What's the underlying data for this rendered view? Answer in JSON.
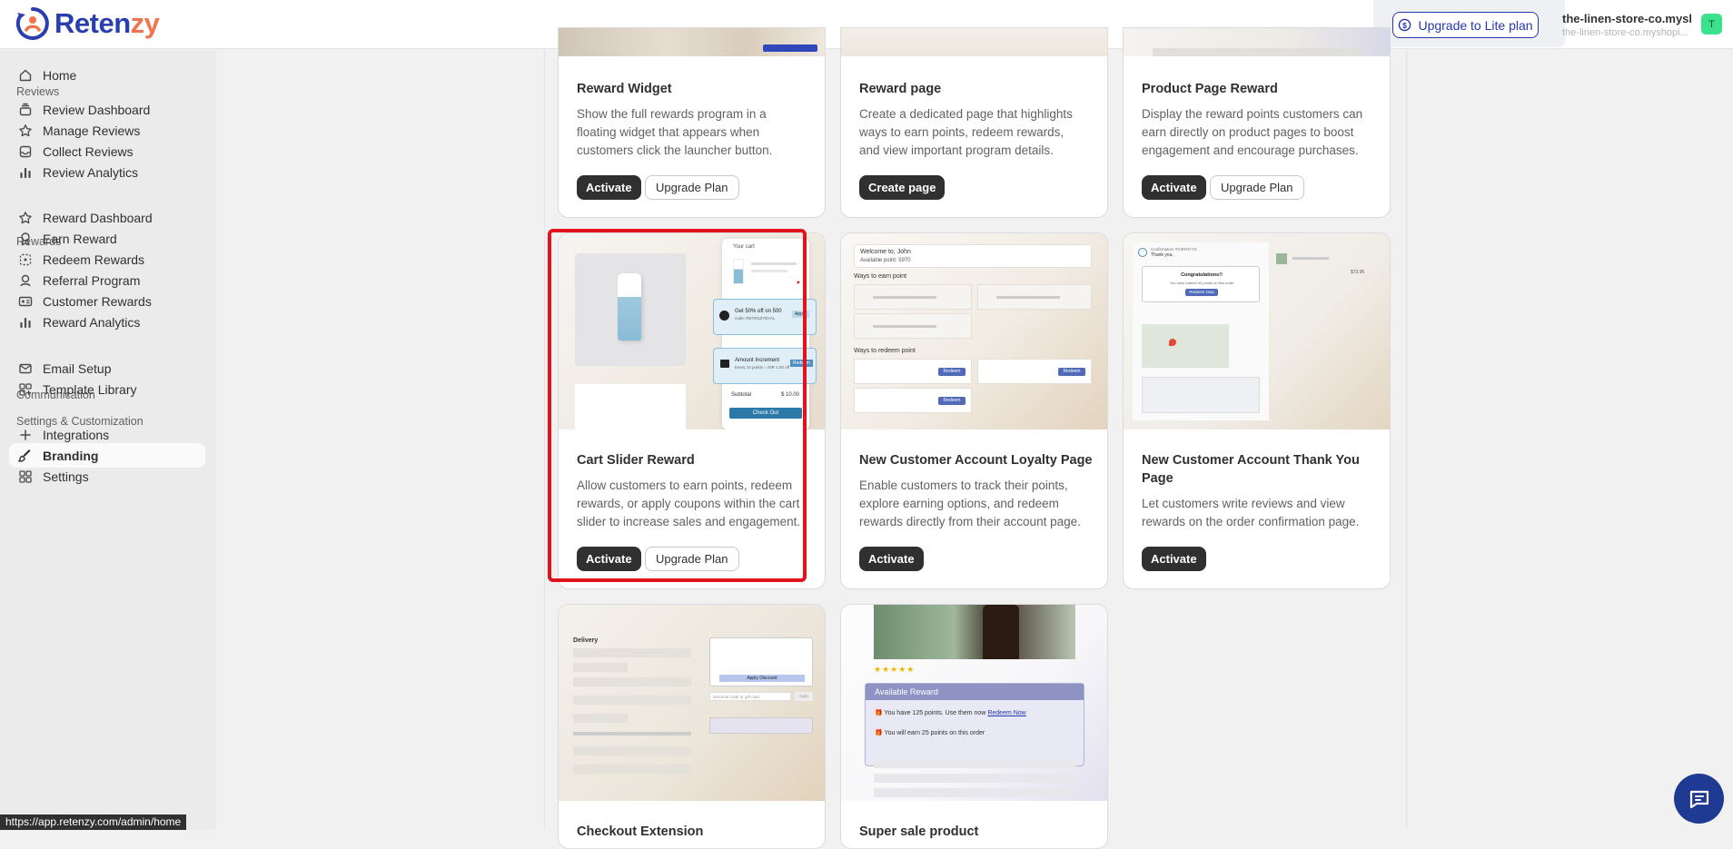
{
  "app": {
    "logo_a": "Reten",
    "logo_b": "zy"
  },
  "topbar": {
    "upgrade_label": "Upgrade to Lite plan",
    "store_name": "the-linen-store-co.mysh...",
    "store_domain": "the-linen-store-co.myshopi...",
    "avatar_letter": "T"
  },
  "sidebar": {
    "home": "Home",
    "reviews_heading": "Reviews",
    "reviews": [
      "Review Dashboard",
      "Manage Reviews",
      "Collect Reviews",
      "Review Analytics"
    ],
    "rewards_heading": "Rewards",
    "rewards": [
      "Reward Dashboard",
      "Earn Reward",
      "Redeem Rewards",
      "Referral Program",
      "Customer Rewards",
      "Reward Analytics"
    ],
    "communication_heading": "Communication",
    "communication": [
      "Email Setup",
      "Template Library"
    ],
    "settings_heading": "Settings & Customization",
    "settings": [
      "Integrations",
      "Branding",
      "Settings"
    ]
  },
  "cards": [
    {
      "title": "Reward Widget",
      "desc": "Show the full rewards program in a floating widget that appears when customers click the launcher button.",
      "primary": "Activate",
      "secondary": "Upgrade Plan"
    },
    {
      "title": "Reward page",
      "desc": "Create a dedicated page that highlights ways to earn points, redeem rewards, and view important program details.",
      "primary": "Create page"
    },
    {
      "title": "Product Page Reward",
      "desc": "Display the reward points customers can earn directly on product pages to boost engagement and encourage purchases.",
      "primary": "Activate",
      "secondary": "Upgrade Plan"
    },
    {
      "title": "Cart Slider Reward",
      "desc": "Allow customers to earn points, redeem rewards, or apply coupons within the cart slider to increase sales and engagement.",
      "primary": "Activate",
      "secondary": "Upgrade Plan"
    },
    {
      "title": "New Customer Account Loyalty Page",
      "desc": "Enable customers to track their points, explore earning options, and redeem rewards directly from their account page.",
      "primary": "Activate"
    },
    {
      "title": "New Customer Account Thank You Page",
      "desc": "Let customers write reviews and view rewards on the order confirmation page.",
      "primary": "Activate"
    },
    {
      "title": "Checkout Extension"
    },
    {
      "title": "Super sale product"
    }
  ],
  "previews": {
    "cart": {
      "heading": "Your cart",
      "coupon": "Get 50% off on 500",
      "coupon_code": "code: RETENZYBYAL",
      "coupon_action": "Apply",
      "points": "Amount Increment",
      "points_sub": "Every 10 points = INR 1.00 off",
      "points_action": "Redeem",
      "subtotal_label": "Subtotal",
      "subtotal_value": "$ 10.00",
      "checkout": "Check Out"
    },
    "loyalty": {
      "welcome": "Welcome to, John",
      "available": "Available point: 5970",
      "earn": "Ways to earn point",
      "redeem": "Ways to redeem point",
      "redeem_btn": "Redeem"
    },
    "thankyou": {
      "order": "Confirmation #G3RNYYS",
      "thanks": "Thank you,",
      "congrats": "Congratulations!!",
      "sub": "You have earned 40 points on this order",
      "btn": "Redeem Now",
      "price": "$73.95"
    },
    "checkout": {
      "heading": "Delivery",
      "apply": "Apply Discount",
      "discount_ph": "Discount code or gift card",
      "discount_btn": "Apply"
    },
    "product": {
      "stars": "★★★★★",
      "available": "Available Reward",
      "line1": "You have 125 points. Use them now",
      "line1_link": "Redeem Now",
      "line2": "You will earn 25 points on this order"
    }
  },
  "status_url": "https://app.retenzy.com/admin/home",
  "colors": {
    "accent": "#2439ad",
    "highlight": "#e2131d",
    "dark_btn": "#303030"
  }
}
